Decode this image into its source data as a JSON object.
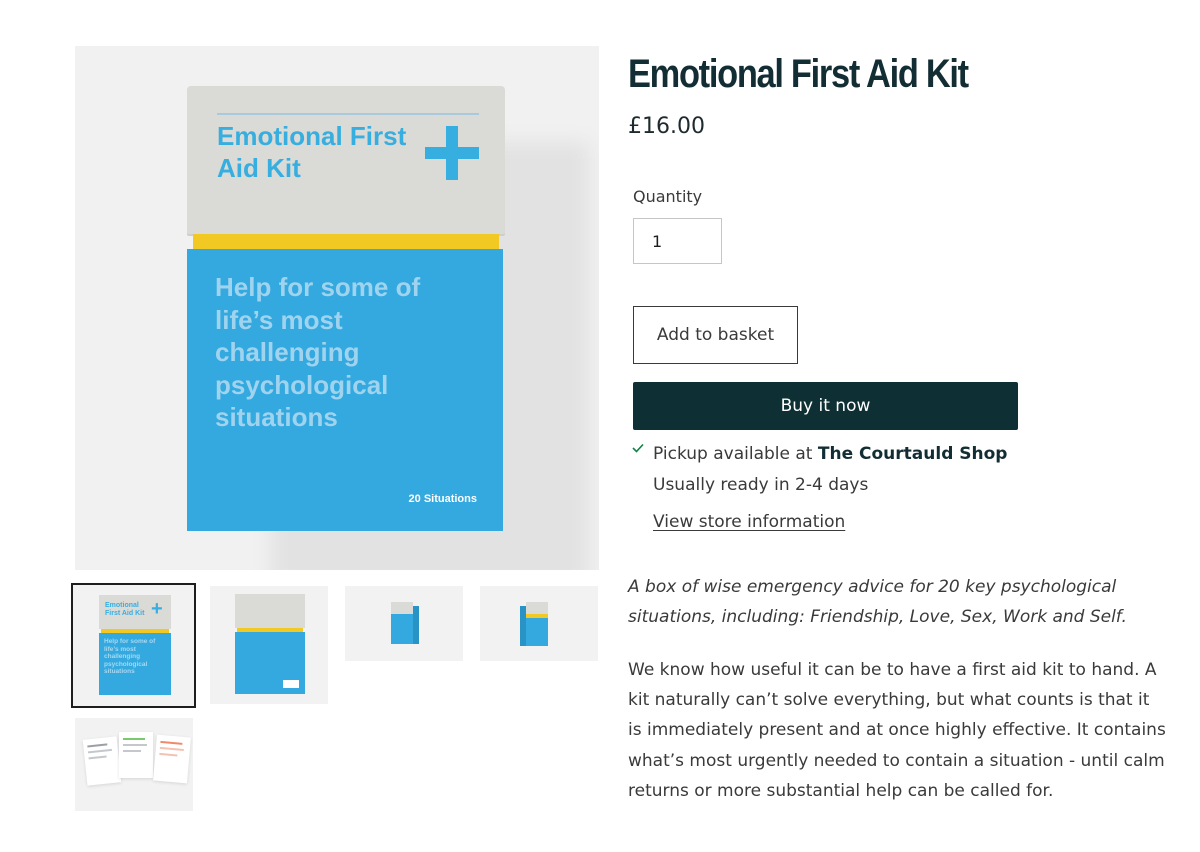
{
  "product": {
    "title": "Emotional First Aid Kit",
    "price": "£16.00",
    "quantity_label": "Quantity",
    "quantity_value": "1",
    "add_to_basket_label": "Add to basket",
    "buy_now_label": "Buy it now",
    "pickup": {
      "prefix": "Pickup available at ",
      "store_name": "The Courtauld Shop",
      "ready_text": "Usually ready in 2-4 days",
      "view_store_link": "View store information"
    },
    "tagline": "A box of wise emergency advice for 20 key psychological situations, including: Friendship, Love, Sex, Work and Self.",
    "description": "We know how useful it can be to have a first aid kit to hand. A kit naturally can’t solve everything, but what counts is that it is immediately present and at once highly effective. It contains what’s most urgently needed to contain a situation - until calm returns or more substantial help can be called for."
  },
  "media": {
    "box_lid_title": "Emotional First Aid Kit",
    "box_body_text": "Help for some of life’s most challenging psychological situations",
    "box_footer": "20 Situations",
    "thumbnail_count": 5,
    "active_thumbnail": 1
  },
  "icons": {
    "pickup_status": "check-icon",
    "box_plus": "plus-icon"
  },
  "colors": {
    "brand_dark": "#0e2f33",
    "title": "#122d33",
    "box_blue": "#33a9e0",
    "box_yellow": "#f2c923",
    "box_lid": "#dadad6",
    "check_green": "#108043"
  }
}
